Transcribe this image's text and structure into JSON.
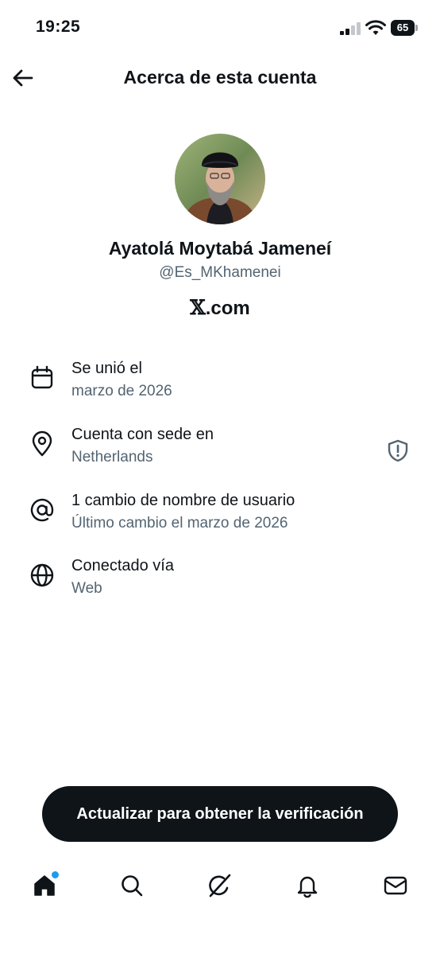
{
  "status_bar": {
    "time": "19:25",
    "battery": "65"
  },
  "header": {
    "title": "Acerca de esta cuenta",
    "back_icon": "arrow-left-icon"
  },
  "profile": {
    "display_name": "Ayatolá Moytabá Jameneí",
    "handle": "@Es_MKhamenei",
    "platform_mark": "𝕏",
    "platform_domain": ".com"
  },
  "info": [
    {
      "icon": "calendar-icon",
      "title": "Se unió el",
      "subtitle": "marzo de 2026"
    },
    {
      "icon": "location-pin-icon",
      "title": "Cuenta con sede en",
      "subtitle": "Netherlands",
      "badge": "shield-icon"
    },
    {
      "icon": "at-sign-icon",
      "title": "1 cambio de nombre de usuario",
      "subtitle": "Último cambio el marzo de 2026"
    },
    {
      "icon": "globe-icon",
      "title": "Conectado vía",
      "subtitle": "Web"
    }
  ],
  "cta": {
    "label": "Actualizar para obtener la verificación"
  },
  "bottom_nav": [
    {
      "icon": "home-icon",
      "active": true,
      "notification_dot": true
    },
    {
      "icon": "search-icon"
    },
    {
      "icon": "grok-icon"
    },
    {
      "icon": "bell-icon"
    },
    {
      "icon": "mail-icon"
    }
  ],
  "colors": {
    "text_primary": "#0f1419",
    "text_secondary": "#536471",
    "accent": "#1d9bf0",
    "button_bg": "#0f1419"
  }
}
